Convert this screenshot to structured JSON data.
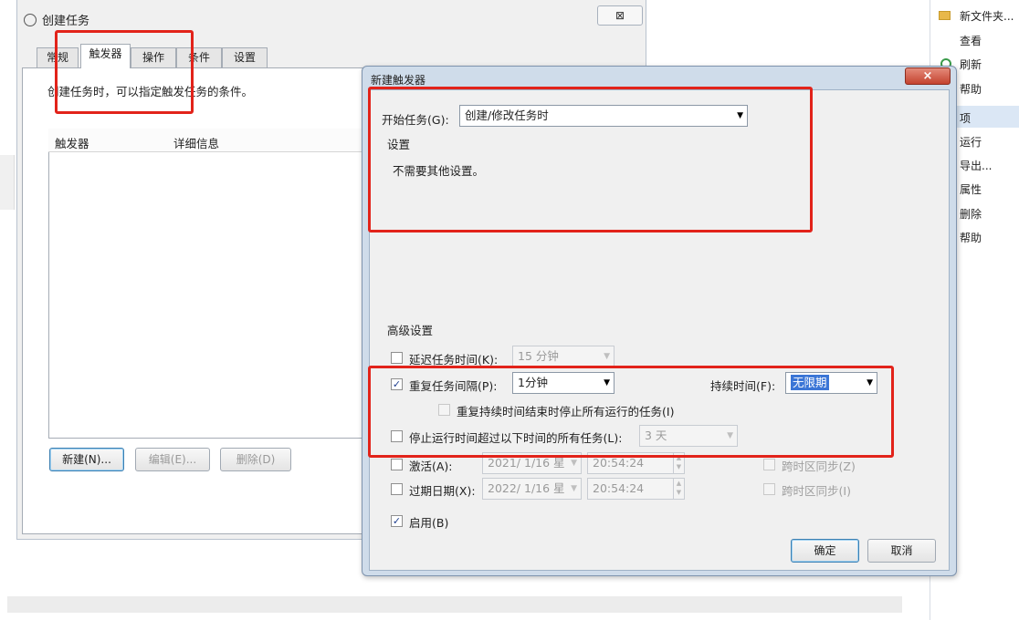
{
  "main_window": {
    "title": "创建任务",
    "close_label": "⊠",
    "tabs": [
      "常规",
      "触发器",
      "操作",
      "条件",
      "设置"
    ],
    "description": "创建任务时，可以指定触发任务的条件。",
    "table_headers": [
      "触发器",
      "详细信息"
    ],
    "buttons": {
      "new": "新建(N)...",
      "edit": "编辑(E)...",
      "delete": "删除(D)"
    }
  },
  "right_pane": {
    "items": [
      "新文件夹...",
      "查看",
      "刷新",
      "帮助",
      "项",
      "运行",
      "导出...",
      "属性",
      "删除",
      "帮助"
    ]
  },
  "dialog": {
    "title": "新建触发器",
    "close_label": "×",
    "begin_label": "开始任务(G):",
    "begin_value": "创建/修改任务时",
    "settings_label": "设置",
    "settings_text": "不需要其他设置。",
    "advanced_label": "高级设置",
    "delay": {
      "label": "延迟任务时间(K):",
      "value": "15 分钟",
      "checked": false
    },
    "repeat": {
      "label": "重复任务间隔(P):",
      "value": "1分钟",
      "checked": true,
      "duration_label": "持续时间(F):",
      "duration_value": "无限期",
      "stop_all_label": "重复持续时间结束时停止所有运行的任务(I)"
    },
    "stop_longer": {
      "label": "停止运行时间超过以下时间的所有任务(L):",
      "value": "3 天"
    },
    "activate": {
      "label": "激活(A):",
      "date": "2021/ 1/16 星",
      "time": "20:54:24",
      "sync_label": "跨时区同步(Z)"
    },
    "expire": {
      "label": "过期日期(X):",
      "date": "2022/ 1/16 星",
      "time": "20:54:24",
      "sync_label": "跨时区同步(I)"
    },
    "enabled": {
      "label": "启用(B)",
      "checked": true
    },
    "ok_label": "确定",
    "cancel_label": "取消"
  },
  "colors": {
    "highlight": "#e2231a",
    "dialog_frame": "#cfdcea",
    "selection": "#3a75d6"
  }
}
